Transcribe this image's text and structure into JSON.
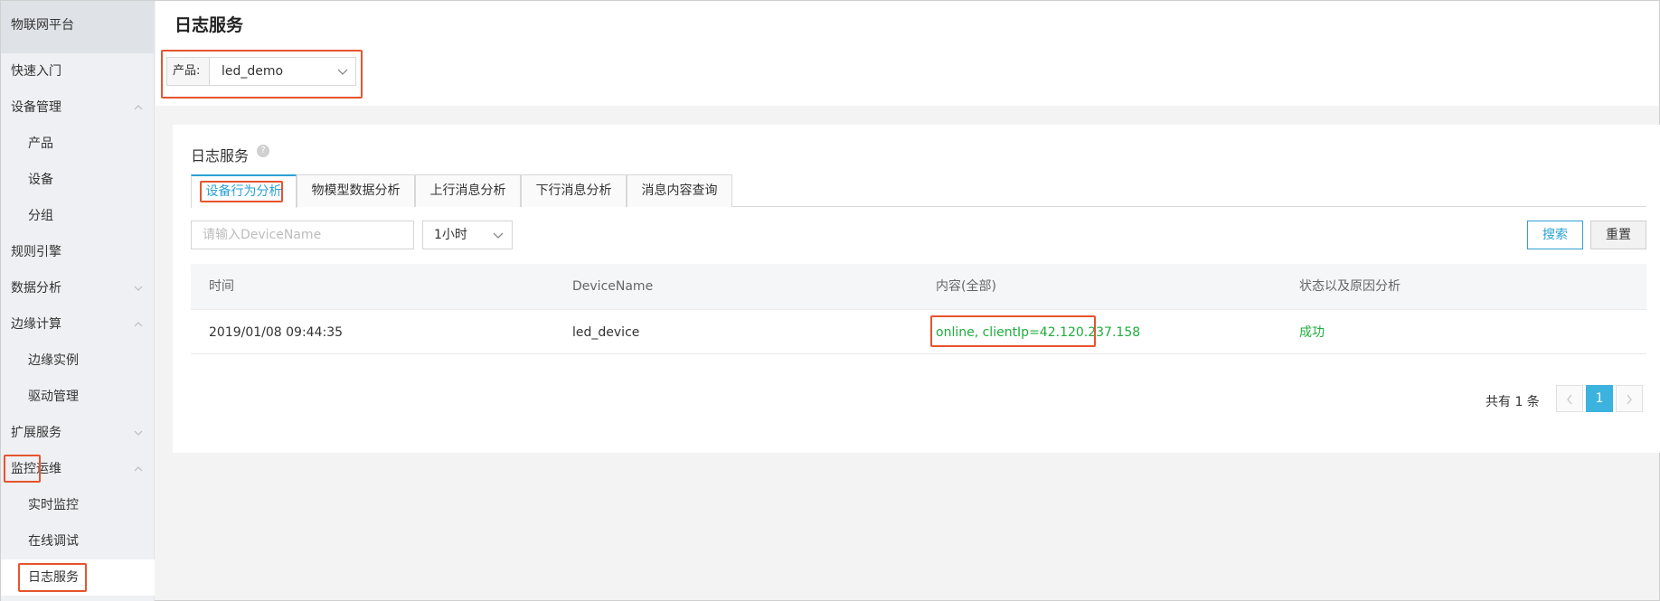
{
  "sidebar": {
    "brand": "物联网平台",
    "items": [
      {
        "label": "快速入门"
      },
      {
        "label": "设备管理",
        "chevron": "chevron-up-icon"
      },
      {
        "label": "产品"
      },
      {
        "label": "设备"
      },
      {
        "label": "分组"
      },
      {
        "label": "规则引擎"
      },
      {
        "label": "数据分析",
        "chevron": "chevron-down-icon"
      },
      {
        "label": "边缘计算",
        "chevron": "chevron-up-icon"
      },
      {
        "label": "边缘实例"
      },
      {
        "label": "驱动管理"
      },
      {
        "label": "扩展服务",
        "chevron": "chevron-down-icon"
      },
      {
        "label": "监控运维",
        "chevron": "chevron-up-icon"
      },
      {
        "label": "实时监控"
      },
      {
        "label": "在线调试"
      },
      {
        "label": "日志服务",
        "active": true
      }
    ]
  },
  "header": {
    "title": "日志服务",
    "product_label": "产品:",
    "product_value": "led_demo"
  },
  "card": {
    "title": "日志服务",
    "help": "?",
    "tabs": [
      {
        "label": "设备行为分析",
        "active": true
      },
      {
        "label": "物模型数据分析"
      },
      {
        "label": "上行消息分析"
      },
      {
        "label": "下行消息分析"
      },
      {
        "label": "消息内容查询"
      }
    ],
    "filters": {
      "device_placeholder": "请输入DeviceName",
      "time_range": "1小时",
      "search_label": "搜索",
      "reset_label": "重置"
    },
    "table": {
      "columns": [
        "时间",
        "DeviceName",
        "内容(全部)",
        "状态以及原因分析"
      ],
      "rows": [
        {
          "time": "2019/01/08 09:44:35",
          "device": "led_device",
          "content": "online, clientIp=42.120.237.158",
          "status": "成功"
        }
      ]
    },
    "pagination": {
      "total_text": "共有 1 条",
      "current_page": "1"
    }
  },
  "colors": {
    "accent": "#2aa1d3",
    "success": "#1fad3d",
    "highlight": "#e6542f",
    "page_active": "#3bb3de"
  }
}
